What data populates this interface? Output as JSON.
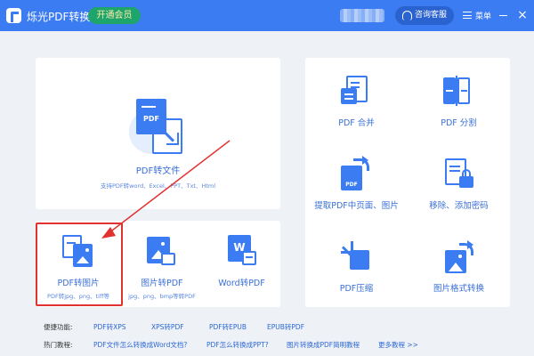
{
  "titlebar": {
    "app_title": "烁光PDF转换器",
    "vip_label": "开通会员",
    "service_label": "咨询客服",
    "menu_label": "菜单",
    "close_glyph": "×",
    "accent_color": "#3b7cf2"
  },
  "main_card": {
    "title": "PDF转文件",
    "subtitle": "支持PDF转word、Excel、PPT、Txt、Html",
    "icon_text": "PDF"
  },
  "image_tiles": [
    {
      "label": "PDF转图片",
      "sub": "PDF转jpg、png、tiff等",
      "icon": "pdf-to-image-icon"
    },
    {
      "label": "图片转PDF",
      "sub": "jpg、png、bmp等转PDF",
      "icon": "image-to-pdf-icon"
    },
    {
      "label": "Word转PDF",
      "sub": "",
      "icon": "word-to-pdf-icon",
      "icon_text": "W"
    }
  ],
  "right_tools": [
    {
      "label": "PDF 合并",
      "icon": "merge-icon"
    },
    {
      "label": "PDF 分割",
      "icon": "split-icon"
    },
    {
      "label": "提取PDF中页面、图片",
      "icon": "extract-icon",
      "icon_text": "PDF"
    },
    {
      "label": "移除、添加密码",
      "icon": "password-icon"
    },
    {
      "label": "PDF压缩",
      "icon": "compress-icon"
    },
    {
      "label": "图片格式转换",
      "icon": "image-convert-icon"
    }
  ],
  "footer": {
    "quick_label": "便捷功能:",
    "quick_links": [
      "PDF转XPS",
      "XPS转PDF",
      "PDF转EPUB",
      "EPUB转PDF"
    ],
    "hot_label": "热门教程:",
    "hot_links": [
      "PDF文件怎么转换成Word文档?",
      "PDF怎么转换成PPT?",
      "图片转换成PDF简明教程",
      "更多教程 >>"
    ]
  },
  "annotation": {
    "highlight_color": "#e0322f"
  }
}
